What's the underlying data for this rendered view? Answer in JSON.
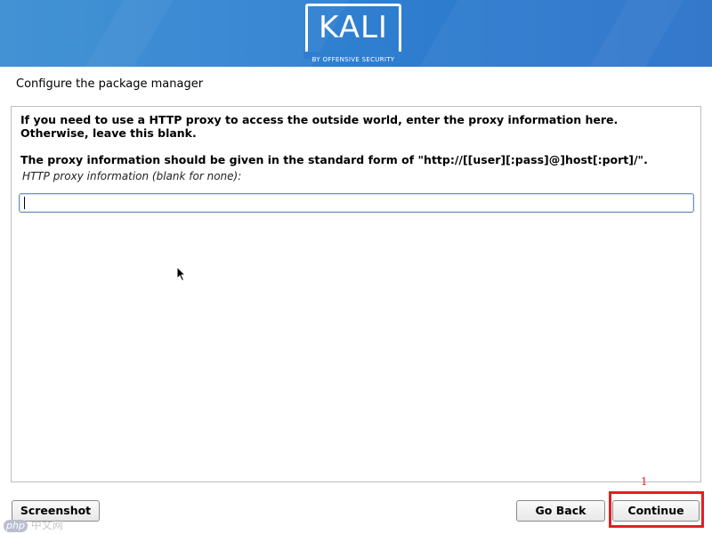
{
  "header": {
    "logo_text": "KALI",
    "logo_subtitle": "BY OFFENSIVE SECURITY",
    "banner_color": "#2f7fd0"
  },
  "page": {
    "title": "Configure the package manager"
  },
  "panel": {
    "description_line1": "If you need to use a HTTP proxy to access the outside world, enter the proxy information here.",
    "description_line2": "Otherwise, leave this blank.",
    "description_line3": "The proxy information should be given in the standard form of \"http://[[user][:pass]@]host[:port]/\".",
    "field_label": "HTTP proxy information (blank for none):",
    "field_value": ""
  },
  "buttons": {
    "screenshot": "Screenshot",
    "back": "Go Back",
    "continue": "Continue"
  },
  "annotation": {
    "number": "1",
    "color": "#e41e26"
  },
  "watermark": {
    "badge": "php",
    "text": "中文网"
  },
  "icons": {
    "pointer": "mouse-pointer-icon"
  }
}
